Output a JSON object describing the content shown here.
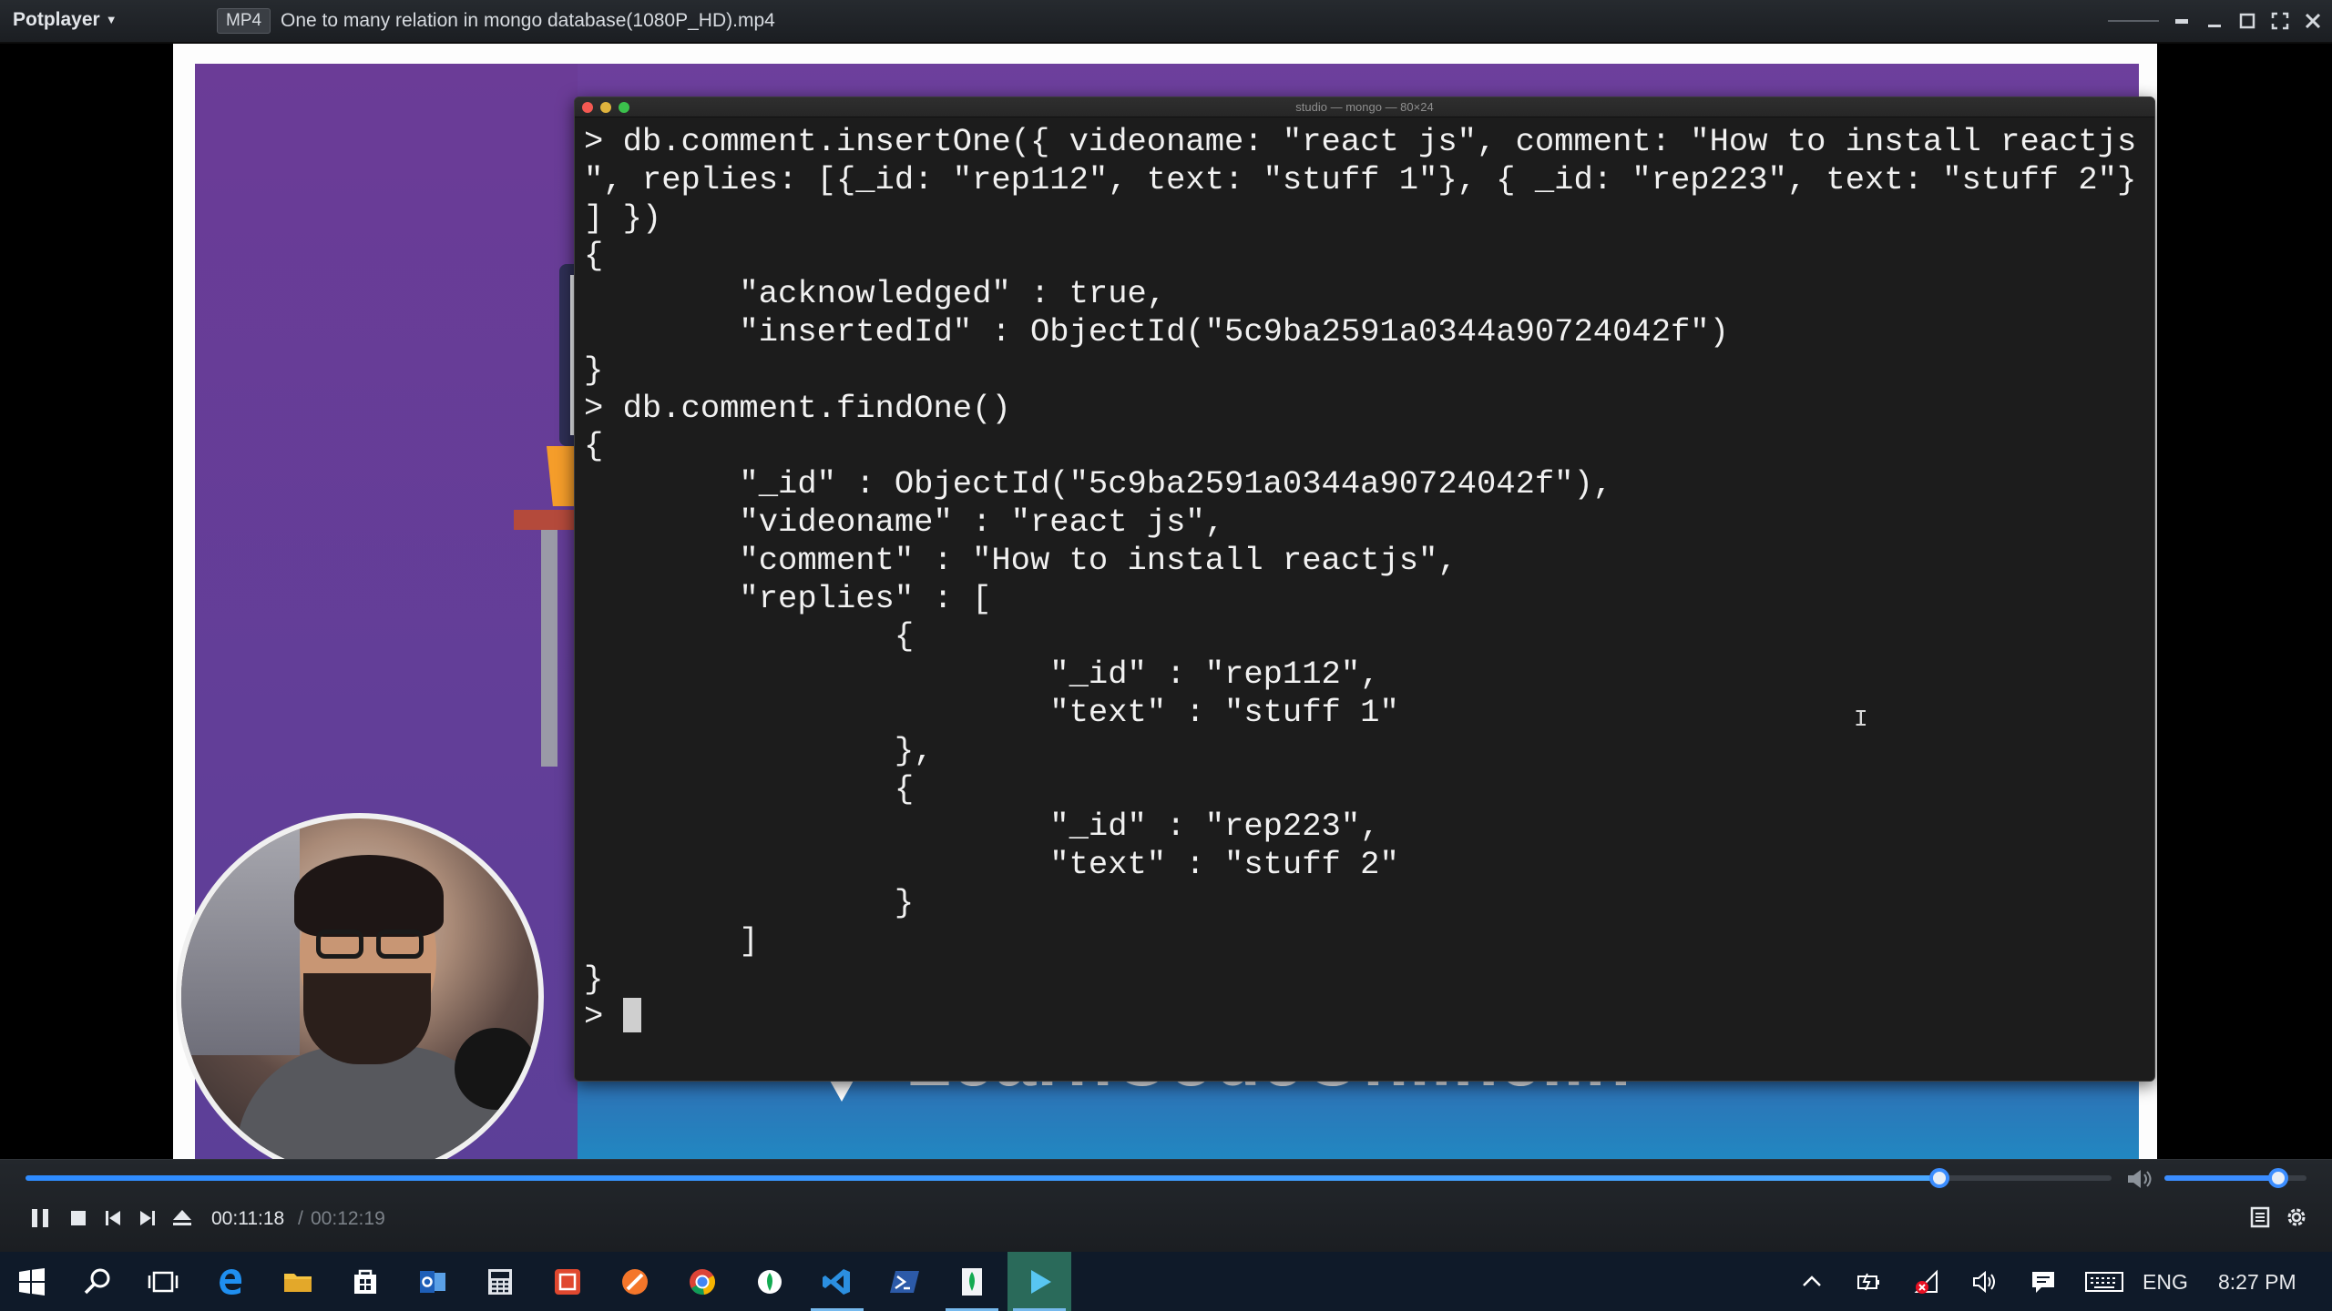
{
  "player": {
    "app_name": "Potplayer",
    "format": "MP4",
    "file_title": "One to many relation in mongo database(1080P_HD).mp4"
  },
  "video": {
    "brand_text": "LearnCodeOnline.in",
    "terminal": {
      "title": "studio — mongo — 80×24",
      "lines": [
        "> db.comment.insertOne({ videoname: \"react js\", comment: \"How to install reactjs",
        "\", replies: [{_id: \"rep112\", text: \"stuff 1\"}, { _id: \"rep223\", text: \"stuff 2\"}",
        "] })",
        "{",
        "        \"acknowledged\" : true,",
        "        \"insertedId\" : ObjectId(\"5c9ba2591a0344a90724042f\")",
        "}",
        "> db.comment.findOne()",
        "{",
        "        \"_id\" : ObjectId(\"5c9ba2591a0344a90724042f\"),",
        "        \"videoname\" : \"react js\",",
        "        \"comment\" : \"How to install reactjs\",",
        "        \"replies\" : [",
        "                {",
        "                        \"_id\" : \"rep112\",",
        "                        \"text\" : \"stuff 1\"",
        "                },",
        "                {",
        "                        \"_id\" : \"rep223\",",
        "                        \"text\" : \"stuff 2\"",
        "                }",
        "        ]",
        "}",
        "> "
      ]
    }
  },
  "controls": {
    "time_current": "00:11:18",
    "time_separator": "/",
    "time_total": "00:12:19",
    "seek_fraction": 0.9175,
    "volume_fraction": 0.8,
    "accent_color": "#3b8dff"
  },
  "taskbar": {
    "apps": [
      "windows-start",
      "search",
      "task-view",
      "edge",
      "file-explorer",
      "store",
      "outlook",
      "calculator",
      "powershell-ise",
      "firefox",
      "chrome",
      "mongodb-compass",
      "vscode",
      "powershell",
      "mongodb",
      "potplayer"
    ],
    "tray": {
      "language": "ENG",
      "clock": "8:27 PM"
    }
  }
}
